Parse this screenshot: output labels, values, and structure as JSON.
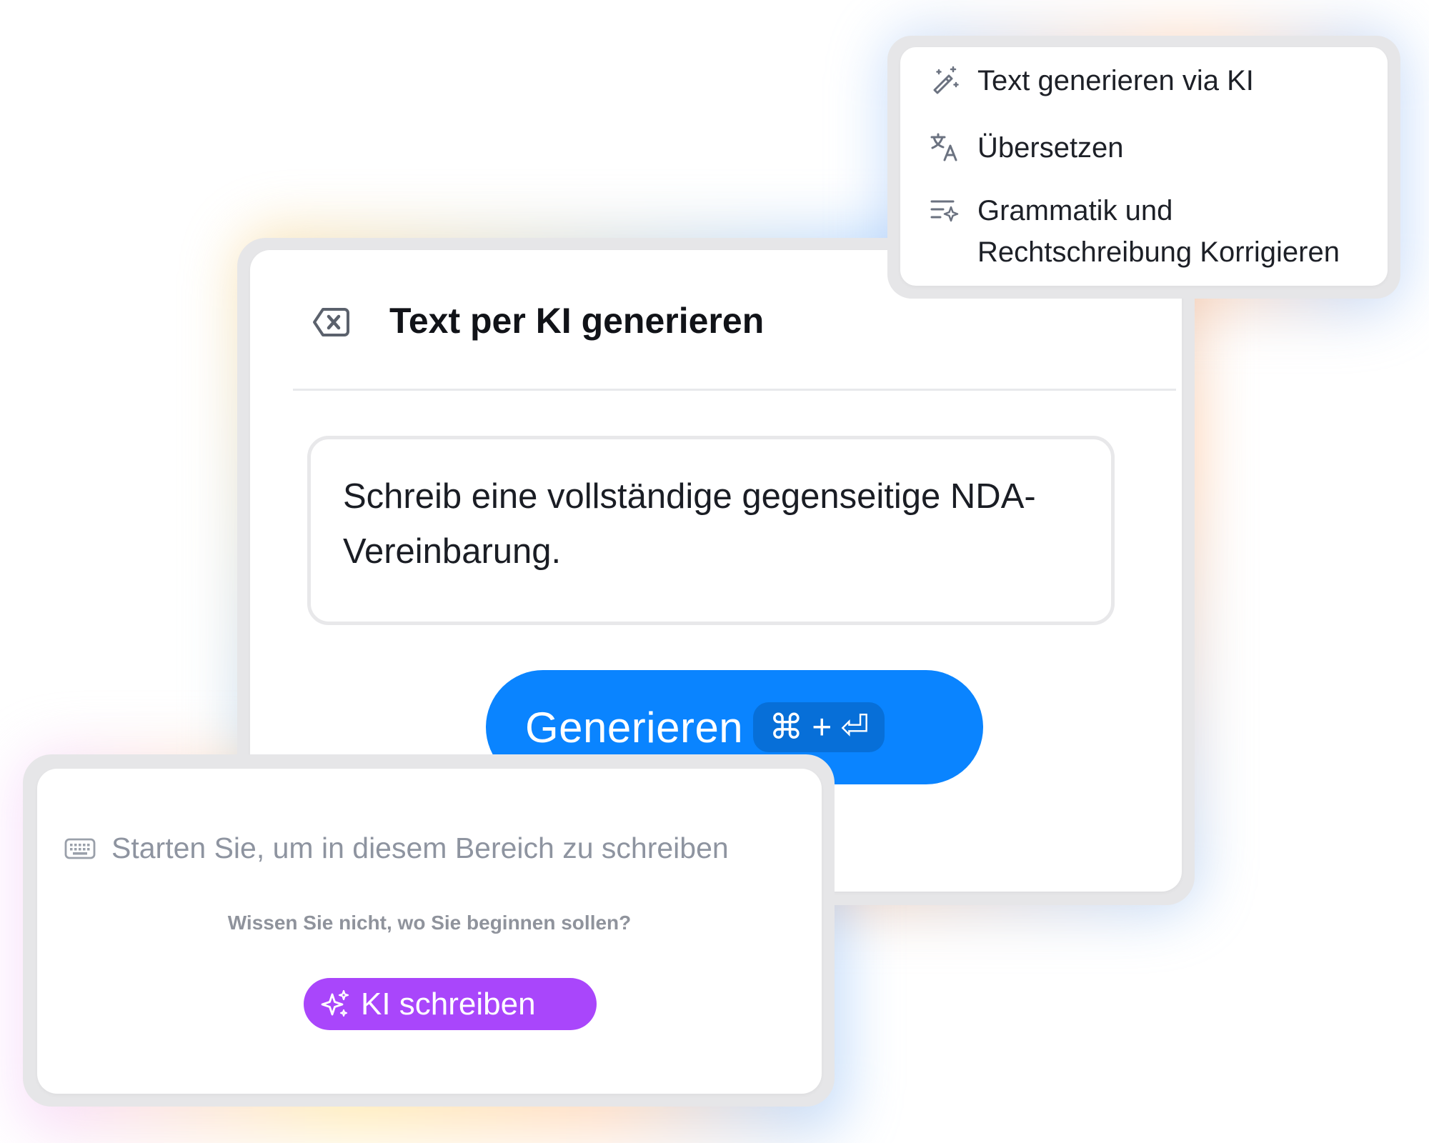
{
  "colors": {
    "primary": "#0a84ff",
    "primary_dark": "#076fd8",
    "ai_purple": "#a946fb",
    "text_dark": "#111318",
    "text_muted": "#8e94a0"
  },
  "dialog": {
    "close_icon": "backspace-x-icon",
    "title": "Text per KI generieren",
    "prompt_text": "Schreib eine vollständige gegenseitige NDA-Vereinbarung.",
    "generate_label": "Generieren",
    "shortcut": {
      "cmd": "⌘",
      "plus": "+",
      "enter": "⏎"
    }
  },
  "ai_menu": {
    "items": [
      {
        "icon": "magic-wand-icon",
        "label": "Text generieren via KI"
      },
      {
        "icon": "translate-icon",
        "label": "Übersetzen"
      },
      {
        "icon": "grammar-sparkle-icon",
        "label": "Grammatik und Rechtschreibung Korrigieren"
      }
    ]
  },
  "editor": {
    "keyboard_icon": "keyboard-icon",
    "placeholder": "Starten Sie, um in diesem Bereich zu schreiben",
    "subtitle": "Wissen Sie nicht, wo Sie beginnen sollen?",
    "ai_button_icon": "sparkles-icon",
    "ai_button_label": "KI schreiben"
  }
}
